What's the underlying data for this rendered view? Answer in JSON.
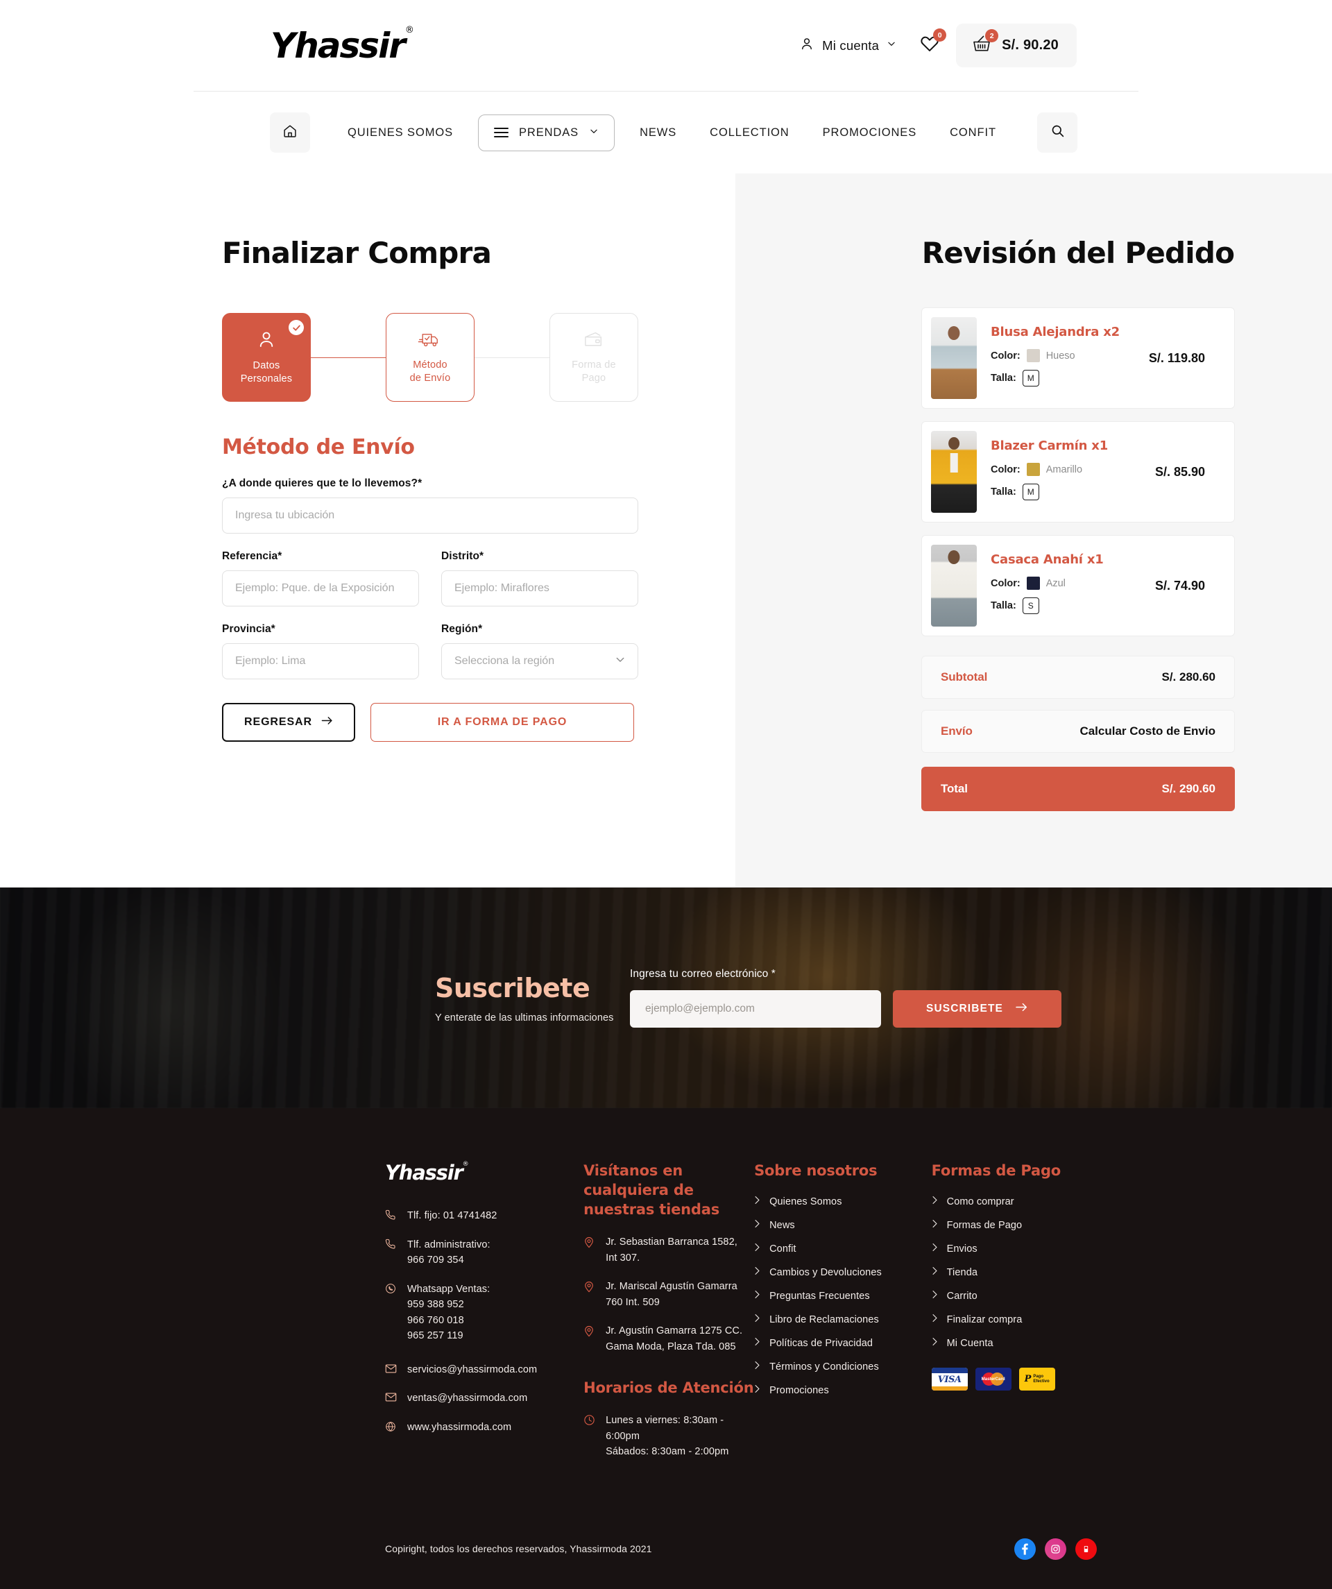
{
  "header": {
    "logo": "Yhassir",
    "logo_mark": "®",
    "account_label": "Mi cuenta",
    "wishlist_count": "0",
    "cart_count": "2",
    "cart_amount": "S/. 90.20"
  },
  "nav": {
    "items": [
      {
        "label": "QUIENES SOMOS"
      },
      {
        "label": "NEWS"
      },
      {
        "label": "COLLECTION"
      },
      {
        "label": "PROMOCIONES"
      },
      {
        "label": "CONFIT"
      }
    ],
    "dropdown_label": "PRENDAS"
  },
  "checkout": {
    "title": "Finalizar Compra",
    "steps": [
      {
        "line1": "Datos",
        "line2": "Personales",
        "state": "done"
      },
      {
        "line1": "Método",
        "line2": "de Envío",
        "state": "active"
      },
      {
        "line1": "Forma de",
        "line2": "Pago",
        "state": "idle"
      }
    ],
    "section_title": "Método de Envío",
    "location_label": "¿A donde quieres que te lo llevemos?*",
    "location_placeholder": "Ingresa tu ubicación",
    "referencia_label": "Referencia*",
    "referencia_placeholder": "Ejemplo: Pque. de la Exposición",
    "distrito_label": "Distrito*",
    "distrito_placeholder": "Ejemplo: Miraflores",
    "provincia_label": "Provincia*",
    "provincia_placeholder": "Ejemplo: Lima",
    "region_label": "Región*",
    "region_placeholder": "Selecciona la región",
    "back_button": "REGRESAR",
    "next_button": "IR A FORMA DE PAGO"
  },
  "order": {
    "title": "Revisión del Pedido",
    "color_key": "Color:",
    "size_key": "Talla:",
    "items": [
      {
        "name": "Blusa Alejandra x2",
        "color_name": "Hueso",
        "color_hex": "#d8d2ca",
        "size": "M",
        "price": "S/. 119.80"
      },
      {
        "name": "Blazer Carmín x1",
        "color_name": "Amarillo",
        "color_hex": "#c9a43c",
        "size": "M",
        "price": "S/. 85.90"
      },
      {
        "name": "Casaca Anahí  x1",
        "color_name": "Azul",
        "color_hex": "#1b1f38",
        "size": "S",
        "price": "S/. 74.90"
      }
    ],
    "subtotal_label": "Subtotal",
    "subtotal_value": "S/. 280.60",
    "shipping_label": "Envío",
    "shipping_value": "Calcular Costo de Envio",
    "total_label": "Total",
    "total_value": "S/. 290.60"
  },
  "newsletter": {
    "title": "Suscribete",
    "subtitle": "Y enterate de las ultimas informaciones",
    "email_label": "Ingresa tu correo electrónico *",
    "email_placeholder": "ejemplo@ejemplo.com",
    "button": "SUSCRIBETE"
  },
  "footer": {
    "logo": "Yhassir",
    "logo_mark": "®",
    "contacts": [
      {
        "icon": "phone-icon",
        "text": "Tlf. fijo: 01 4741482"
      },
      {
        "icon": "phone-icon",
        "text": "Tlf. administrativo:\n966 709 354"
      },
      {
        "icon": "whatsapp-icon",
        "text": "Whatsapp Ventas:\n959 388 952\n966 760 018\n965 257 119"
      },
      {
        "icon": "mail-icon",
        "text": "servicios@yhassirmoda.com"
      },
      {
        "icon": "mail-icon",
        "text": "ventas@yhassirmoda.com"
      },
      {
        "icon": "globe-icon",
        "text": "www.yhassirmoda.com"
      }
    ],
    "stores_title": "Visítanos en cualquiera de nuestras tiendas",
    "stores": [
      "Jr. Sebastian Barranca 1582,\nInt 307.",
      "Jr. Mariscal Agustín Gamarra\n760 Int. 509",
      "Jr. Agustín Gamarra 1275 CC.\nGama Moda, Plaza Tda. 085"
    ],
    "hours_title": "Horarios de Atención",
    "hours": "Lunes a viernes: 8:30am - 6:00pm\nSábados: 8:30am  -  2:00pm",
    "about_title": "Sobre nosotros",
    "about_links": [
      "Quienes Somos",
      "News",
      "Confit",
      "Cambios y Devoluciones",
      "Preguntas Frecuentes",
      "Libro de Reclamaciones",
      "Políticas de Privacidad",
      "Términos y Condiciones",
      "Promociones"
    ],
    "payment_title": "Formas de Pago",
    "payment_links": [
      "Como comprar",
      "Formas de Pago",
      "Envios",
      "Tienda",
      "Carrito",
      "Finalizar compra",
      "Mi Cuenta"
    ],
    "payment_logos": [
      "VISA Electron",
      "MasterCard",
      "Pago Efectivo"
    ],
    "copyright": "Copiright, todos los derechos reservados, Yhassirmoda 2021",
    "socials": [
      "facebook-icon",
      "instagram-icon",
      "youtube-icon"
    ]
  },
  "theme": {
    "accent": "#d35843",
    "dark": "#181212",
    "panel": "#f6f6f6"
  }
}
